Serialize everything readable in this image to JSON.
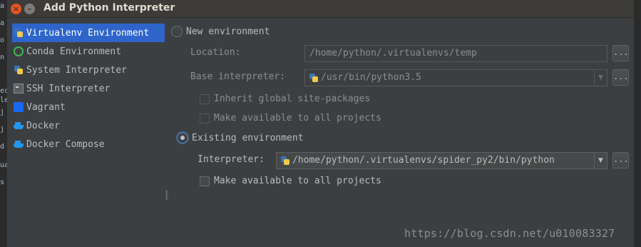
{
  "window": {
    "title": "Add Python Interpreter"
  },
  "edge_glyphs": [
    "a",
    "a",
    "o",
    "n",
    "ec",
    "le",
    "j",
    "j",
    "d",
    "ua",
    "s"
  ],
  "sidebar": {
    "items": [
      {
        "label": "Virtualenv Environment",
        "icon": "python-icon",
        "selected": true
      },
      {
        "label": "Conda Environment",
        "icon": "conda-icon",
        "selected": false
      },
      {
        "label": "System Interpreter",
        "icon": "python-icon",
        "selected": false
      },
      {
        "label": "SSH Interpreter",
        "icon": "terminal-icon",
        "selected": false
      },
      {
        "label": "Vagrant",
        "icon": "vagrant-icon",
        "selected": false
      },
      {
        "label": "Docker",
        "icon": "docker-icon",
        "selected": false
      },
      {
        "label": "Docker Compose",
        "icon": "docker-icon",
        "selected": false
      }
    ]
  },
  "new_env": {
    "radio_label": "New environment",
    "checked": false,
    "location_label": "Location:",
    "location_value": "/home/python/.virtualenvs/temp",
    "base_label": "Base interpreter:",
    "base_value": "/usr/bin/python3.5",
    "inherit_label": "Inherit global site-packages",
    "available_label": "Make available to all projects"
  },
  "existing_env": {
    "radio_label": "Existing environment",
    "checked": true,
    "interpreter_label": "Interpreter:",
    "interpreter_value": "/home/python/.virtualenvs/spider_py2/bin/python",
    "available_label": "Make available to all projects"
  },
  "browse_button": "...",
  "watermark": "https://blog.csdn.net/u010083327",
  "colors": {
    "background": "#3c3f41",
    "selection": "#2f65ca",
    "title_bar": "#3c3b37",
    "close_button": "#e95420"
  }
}
